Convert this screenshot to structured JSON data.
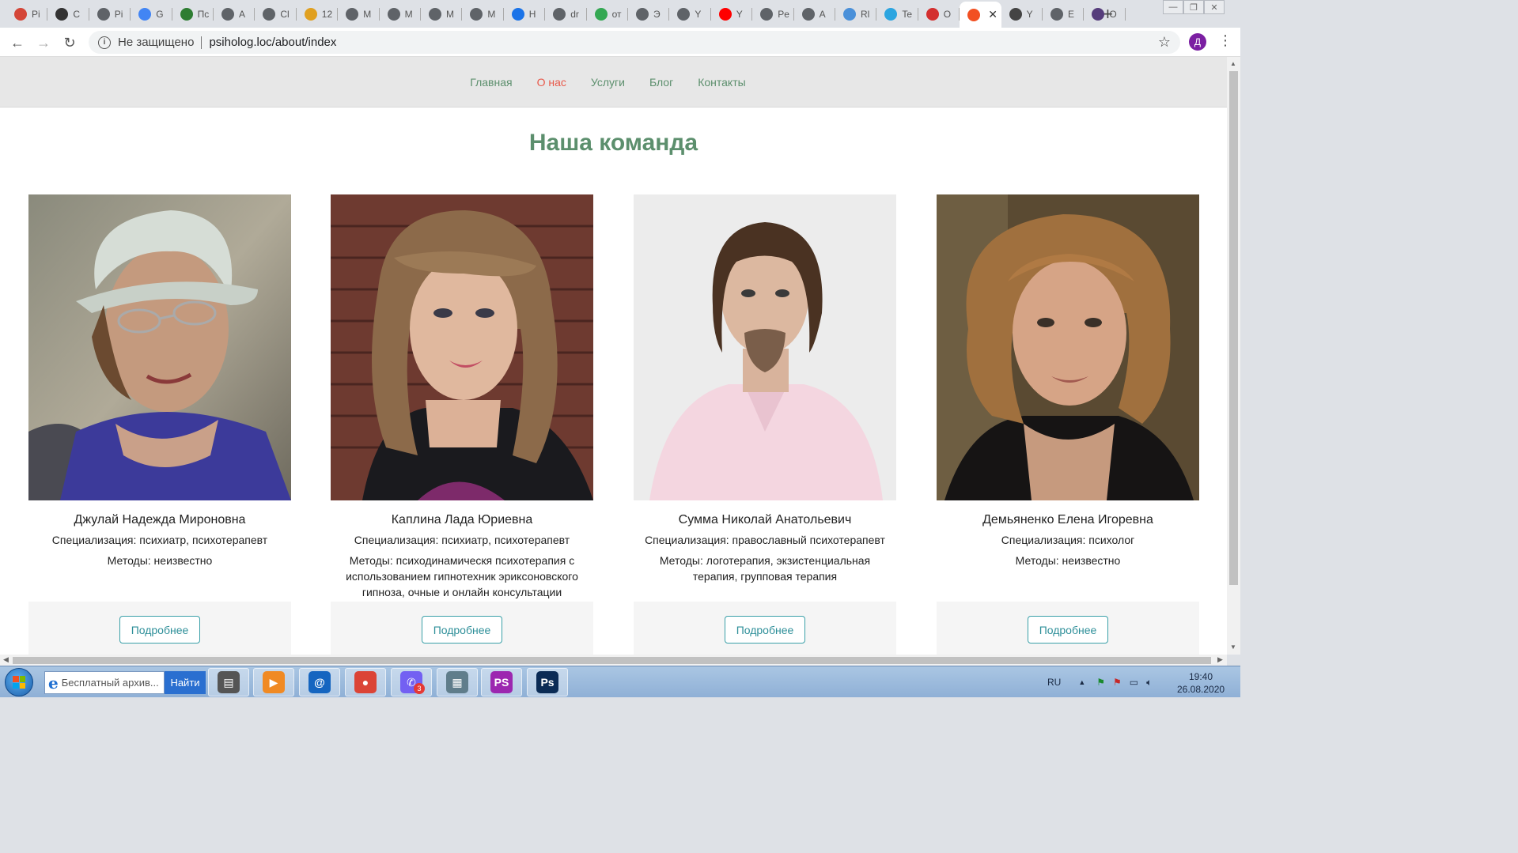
{
  "browser": {
    "tabs": [
      {
        "short": "Pi",
        "icon": "gmail-icon",
        "color": "#d44638"
      },
      {
        "short": "C",
        "icon": "clover-icon",
        "color": "#333333"
      },
      {
        "short": "Pi",
        "icon": "globe-icon",
        "color": "#5f6368"
      },
      {
        "short": "G",
        "icon": "translate-icon",
        "color": "#4285f4"
      },
      {
        "short": "Пc",
        "icon": "m-logo-icon",
        "color": "#2e7d32"
      },
      {
        "short": "A",
        "icon": "globe-icon",
        "color": "#5f6368"
      },
      {
        "short": "Cl",
        "icon": "globe-icon",
        "color": "#5f6368"
      },
      {
        "short": "12",
        "icon": "rma-icon",
        "color": "#e0a020"
      },
      {
        "short": "M",
        "icon": "globe-icon",
        "color": "#5f6368"
      },
      {
        "short": "M",
        "icon": "globe-icon",
        "color": "#5f6368"
      },
      {
        "short": "M",
        "icon": "globe-icon",
        "color": "#5f6368"
      },
      {
        "short": "M",
        "icon": "globe-icon",
        "color": "#5f6368"
      },
      {
        "short": "H",
        "icon": "gear-icon",
        "color": "#1a73e8"
      },
      {
        "short": "dr",
        "icon": "globe-icon",
        "color": "#5f6368"
      },
      {
        "short": "от",
        "icon": "maps-pin-icon",
        "color": "#34a853"
      },
      {
        "short": "Э",
        "icon": "globe-icon",
        "color": "#5f6368"
      },
      {
        "short": "Y",
        "icon": "globe-icon",
        "color": "#5f6368"
      },
      {
        "short": "Y",
        "icon": "youtube-icon",
        "color": "#ff0000"
      },
      {
        "short": "Pe",
        "icon": "globe-icon",
        "color": "#5f6368"
      },
      {
        "short": "A",
        "icon": "globe-icon",
        "color": "#5f6368"
      },
      {
        "short": "Rl",
        "icon": "doc-icon",
        "color": "#4a90d9"
      },
      {
        "short": "Te",
        "icon": "telegram-icon",
        "color": "#2ca5e0"
      },
      {
        "short": "O",
        "icon": "gear-red-icon",
        "color": "#d32f2f"
      },
      {
        "short": "",
        "icon": "ms-grid-icon",
        "color": "#f25022",
        "active": true
      },
      {
        "short": "Y",
        "icon": "world-icon",
        "color": "#444444"
      },
      {
        "short": "E",
        "icon": "globe-icon",
        "color": "#5f6368"
      },
      {
        "short": "O",
        "icon": "b-logo-icon",
        "color": "#563d7c"
      }
    ],
    "new_tab": "+",
    "security_label": "Не защищено",
    "url": "psiholog.loc/about/index",
    "profile_letter": "Д"
  },
  "site": {
    "nav": [
      {
        "label": "Главная",
        "active": false
      },
      {
        "label": "О нас",
        "active": true
      },
      {
        "label": "Услуги",
        "active": false
      },
      {
        "label": "Блог",
        "active": false
      },
      {
        "label": "Контакты",
        "active": false
      }
    ],
    "heading": "Наша команда",
    "more_label": "Подробнее",
    "team": [
      {
        "name": "Джулай Надежда Мироновна",
        "specialization": "Специализация: психиатр, психотерапевт",
        "methods": "Методы: неизвестно",
        "photo": "woman-in-hat-photo"
      },
      {
        "name": "Каплина Лада Юриевна",
        "specialization": "Специализация: психиатр, психотерапевт",
        "methods": "Методы: психодинамическя психотерапия с использованием гипнотехник эриксоновского гипноза, очные и онлайн консультации",
        "photo": "woman-brick-wall-photo"
      },
      {
        "name": "Сумма Николай Анатольевич",
        "specialization": "Специализация: православный психотерапевт",
        "methods": "Методы: логотерапия, экзистенциальная терапия, групповая терапия",
        "photo": "man-pink-shirt-photo"
      },
      {
        "name": "Демьяненко Елена Игоревна",
        "specialization": "Специализация: психолог",
        "methods": "Методы: неизвестно",
        "photo": "woman-curly-hair-photo"
      }
    ]
  },
  "taskbar": {
    "search_text": "Бесплатный архив...",
    "search_button": "Найти",
    "apps": [
      {
        "name": "printer-app-icon",
        "color": "#555555",
        "glyph": "▤"
      },
      {
        "name": "media-player-icon",
        "color": "#f08a24",
        "glyph": "▶"
      },
      {
        "name": "mail-agent-icon",
        "color": "#1565c0",
        "glyph": "@"
      },
      {
        "name": "chrome-icon",
        "color": "#db4437",
        "glyph": "●"
      },
      {
        "name": "viber-icon",
        "color": "#7360f2",
        "glyph": "✆"
      },
      {
        "name": "calculator-icon",
        "color": "#607d8b",
        "glyph": "▦"
      },
      {
        "name": "phpstorm-icon",
        "color": "#9c27b0",
        "glyph": "PS"
      },
      {
        "name": "photoshop-icon",
        "color": "#0b2b55",
        "glyph": "Ps"
      }
    ],
    "viber_badge": "3",
    "lang": "RU",
    "time": "19:40",
    "date": "26.08.2020"
  }
}
